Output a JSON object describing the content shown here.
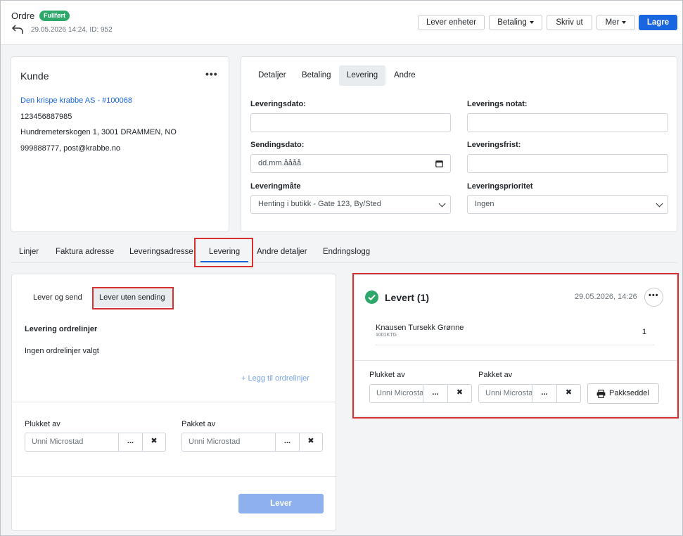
{
  "header": {
    "title": "Ordre",
    "status_badge": "Fullført",
    "meta": "29.05.2026 14:24, ID: 952",
    "buttons": {
      "lever_enheter": "Lever enheter",
      "betaling": "Betaling",
      "skriv_ut": "Skriv ut",
      "mer": "Mer",
      "lagre": "Lagre"
    }
  },
  "customer": {
    "heading": "Kunde",
    "name_link": "Den krispe krabbe AS - #100068",
    "org_number": "123456887985",
    "address": "Hundremeterskogen 1, 3001 DRAMMEN, NO",
    "contact": "999888777, post@krabbe.no"
  },
  "detail_tabs": [
    "Detaljer",
    "Betaling",
    "Levering",
    "Andre"
  ],
  "delivery_form": {
    "leveringsdato_label": "Leveringsdato:",
    "leveringsdato_value": "",
    "leverings_notat_label": "Leverings notat:",
    "leverings_notat_value": "",
    "sendingsdato_label": "Sendingsdato:",
    "sendingsdato_placeholder": "dd.mm.åååå",
    "leveringsfrist_label": "Leveringsfrist:",
    "leveringsfrist_value": "",
    "leveringsmate_label": "Leveringmåte",
    "leveringsmate_value": "Henting i butikk - Gate 123, By/Sted",
    "leveringsprioritet_label": "Leveringsprioritet",
    "leveringsprioritet_value": "Ingen"
  },
  "main_tabs": [
    "Linjer",
    "Faktura adresse",
    "Leveringsadresse",
    "Levering",
    "Andre detaljer",
    "Endringslogg"
  ],
  "lever_panel": {
    "subtabs": [
      "Lever og send",
      "Lever uten sending"
    ],
    "section_title": "Levering ordrelinjer",
    "empty_text": "Ingen ordrelinjer valgt",
    "add_link": "+ Legg til ordrelinjer",
    "plukket_label": "Plukket av",
    "plukket_value": "Unni Microstad",
    "pakket_label": "Pakket av",
    "pakket_value": "Unni Microstad",
    "ellipsis": "...",
    "clear": "✖",
    "submit": "Lever"
  },
  "levert_panel": {
    "title": "Levert (1)",
    "timestamp": "29.05.2026, 14:26",
    "item_name": "Knausen Tursekk Grønne",
    "item_sku": "1001KTG",
    "item_qty": "1",
    "plukket_label": "Plukket av",
    "plukket_value": "Unni Microstad",
    "pakket_label": "Pakket av",
    "pakket_value": "Unni Microstad",
    "ellipsis": "...",
    "clear": "✖",
    "pakkseddel": "Pakkseddel"
  },
  "colors": {
    "accent": "#1a66e0",
    "success": "#2ea86a",
    "highlight": "#d63031",
    "link": "#1a66e0"
  }
}
